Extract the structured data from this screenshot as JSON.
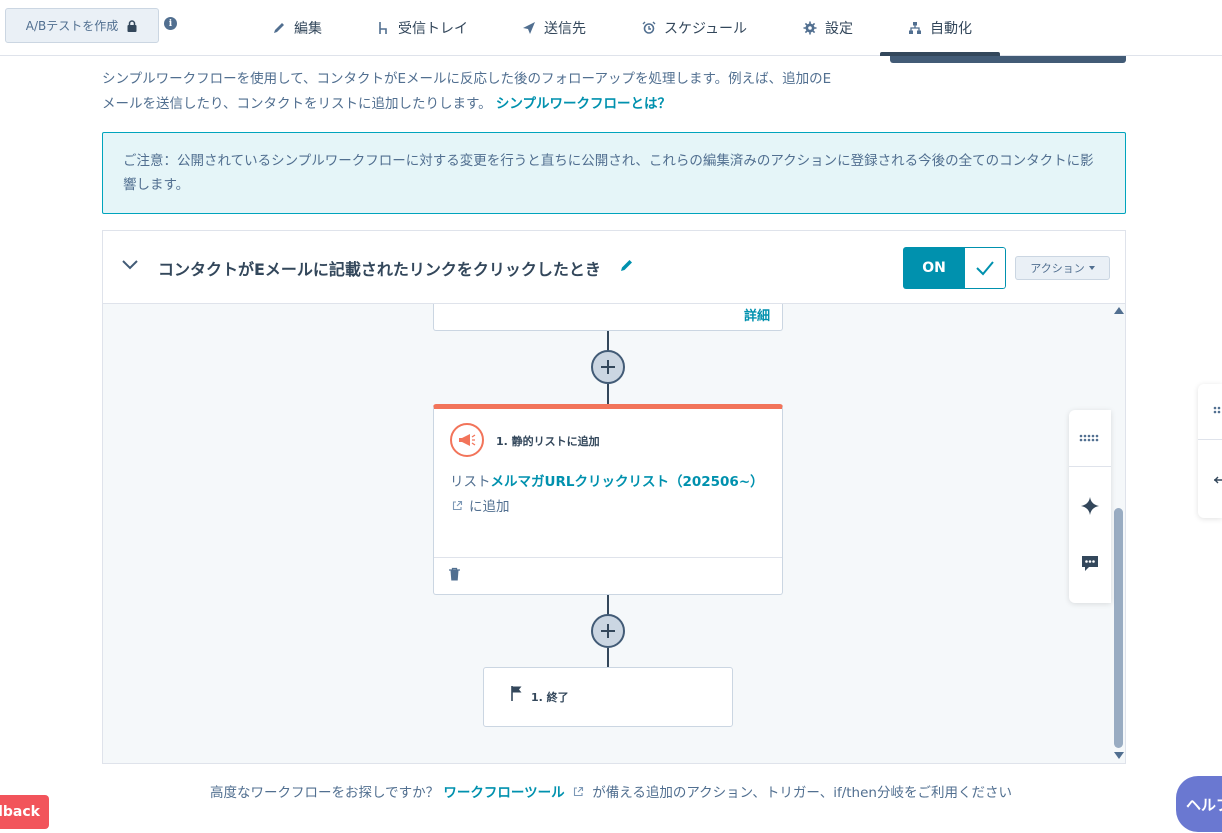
{
  "topbar": {
    "ab_test_label": "A/Bテストを作成",
    "tabs": [
      {
        "label": "編集",
        "icon": "pencil-icon"
      },
      {
        "label": "受信トレイ",
        "icon": "branch-icon"
      },
      {
        "label": "送信先",
        "icon": "send-icon"
      },
      {
        "label": "スケジュール",
        "icon": "alarm-icon"
      },
      {
        "label": "設定",
        "icon": "gear-icon"
      },
      {
        "label": "自動化",
        "icon": "workflow-icon",
        "active": true
      }
    ]
  },
  "intro": {
    "text": "シンプルワークフローを使用して、コンタクトがEメールに反応した後のフォローアップを処理します。例えば、追加のEメールを送信したり、コンタクトをリストに追加したりします。",
    "link": "シンプルワークフローとは？"
  },
  "notice": {
    "text": "ご注意：公開されているシンプルワークフローに対する変更を行うと直ちに公開され、これらの編集済みのアクションに登録される今後の全てのコンタクトに影響します。"
  },
  "workflow": {
    "title": "コンタクトがEメールに記載されたリンクをクリックしたとき",
    "toggle_label": "ON",
    "actions_label": "アクション",
    "detail_link": "詳細",
    "action_card": {
      "title": "1. 静的リストに追加",
      "prefix": "リスト",
      "list_name": "メルマガURLクリックリスト（202506~）",
      "suffix": "に追加"
    },
    "end_card": {
      "label": "1. 終了"
    }
  },
  "footer": {
    "prefix": "高度なワークフローをお探しですか？",
    "link": "ワークフローツール",
    "suffix": "が備える追加のアクション、トリガー、if/then分岐をご利用ください"
  },
  "feedback_label": "dback",
  "help_label": "ヘルプ",
  "colors": {
    "accent": "#0091ae",
    "action_bar": "#f2745a",
    "notice_bg": "#e5f5f8",
    "feedback": "#f2545b",
    "help": "#6a78d1"
  }
}
